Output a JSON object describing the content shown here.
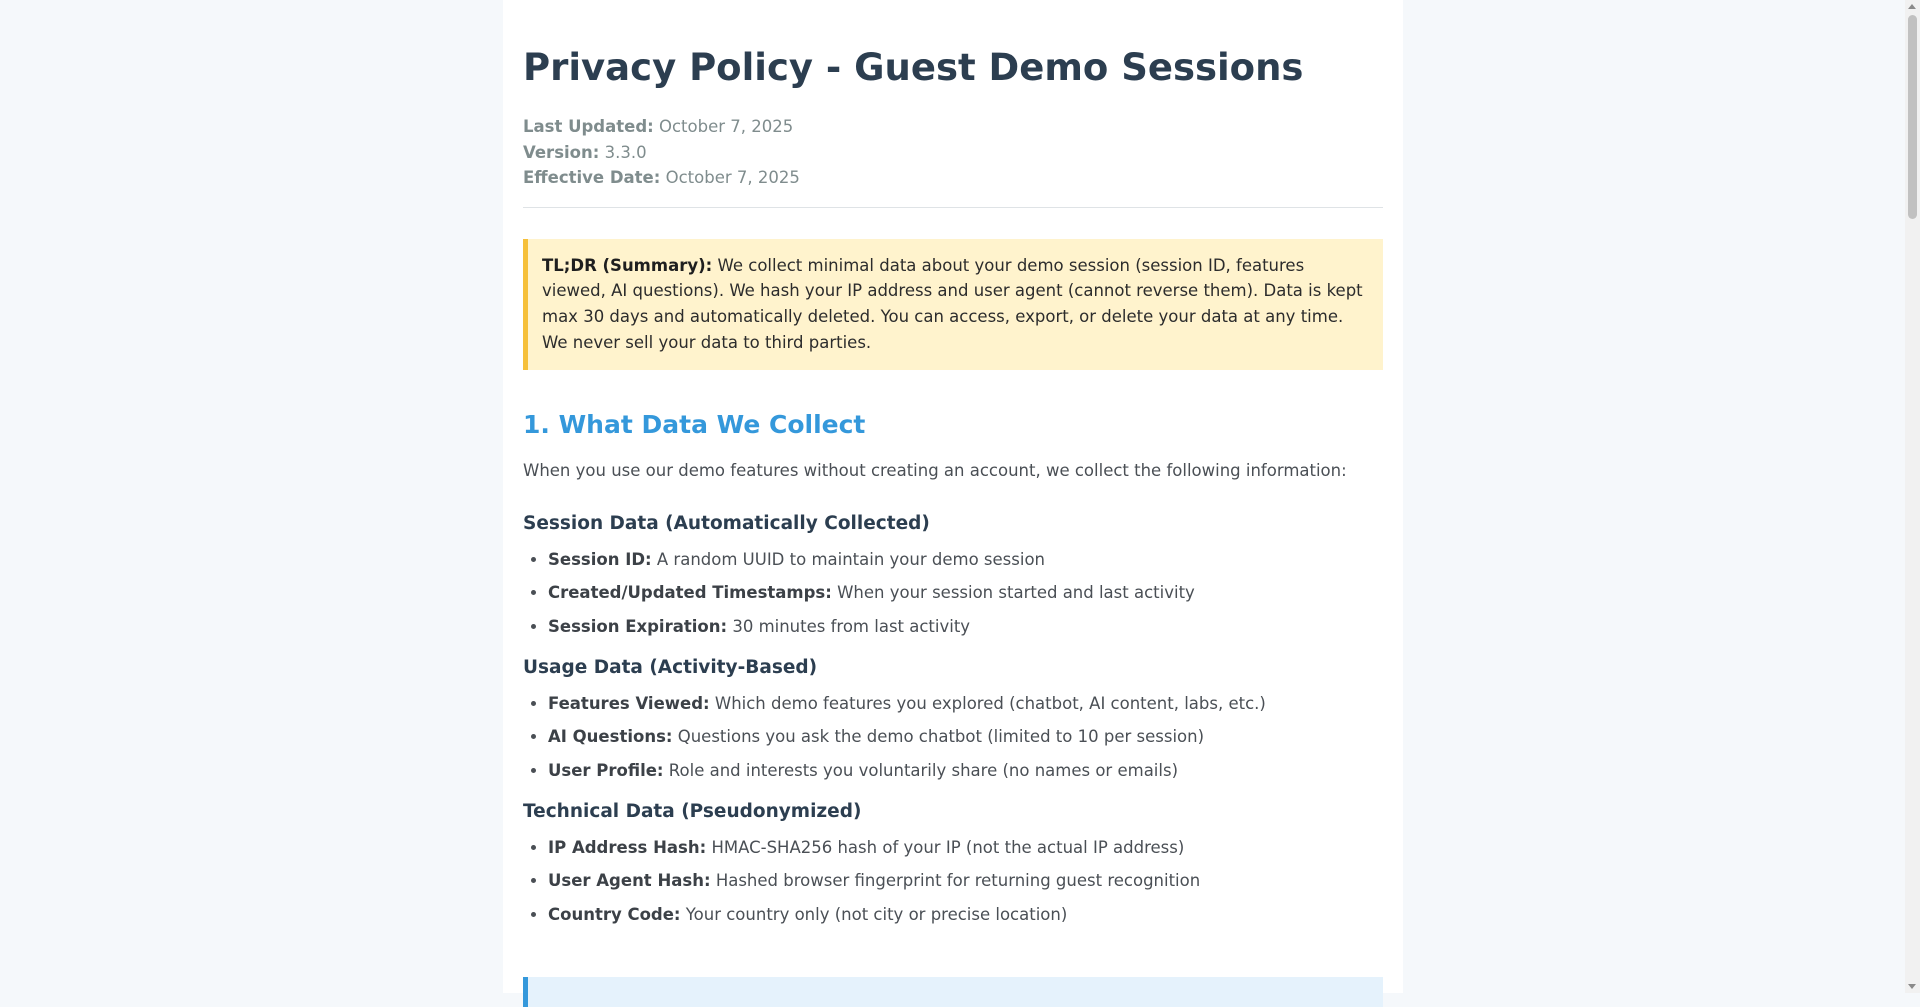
{
  "document": {
    "title": "Privacy Policy - Guest Demo Sessions",
    "meta": [
      {
        "label": "Last Updated:",
        "value": "October 7, 2025"
      },
      {
        "label": "Version:",
        "value": "3.3.0"
      },
      {
        "label": "Effective Date:",
        "value": "October 7, 2025"
      }
    ],
    "tldr": {
      "label": "TL;DR (Summary):",
      "text": "We collect minimal data about your demo session (session ID, features viewed, AI questions). We hash your IP address and user agent (cannot reverse them). Data is kept max 30 days and automatically deleted. You can access, export, or delete your data at any time. We never sell your data to third parties."
    },
    "section1": {
      "heading": "1. What Data We Collect",
      "intro": "When you use our demo features without creating an account, we collect the following information:",
      "groups": [
        {
          "title": "Session Data (Automatically Collected)",
          "items": [
            {
              "label": "Session ID:",
              "text": "A random UUID to maintain your demo session"
            },
            {
              "label": "Created/Updated Timestamps:",
              "text": "When your session started and last activity"
            },
            {
              "label": "Session Expiration:",
              "text": "30 minutes from last activity"
            }
          ]
        },
        {
          "title": "Usage Data (Activity-Based)",
          "items": [
            {
              "label": "Features Viewed:",
              "text": "Which demo features you explored (chatbot, AI content, labs, etc.)"
            },
            {
              "label": "AI Questions:",
              "text": "Questions you ask the demo chatbot (limited to 10 per session)"
            },
            {
              "label": "User Profile:",
              "text": "Role and interests you voluntarily share (no names or emails)"
            }
          ]
        },
        {
          "title": "Technical Data (Pseudonymized)",
          "items": [
            {
              "label": "IP Address Hash:",
              "text": "HMAC-SHA256 hash of your IP (not the actual IP address)"
            },
            {
              "label": "User Agent Hash:",
              "text": "Hashed browser fingerprint for returning guest recognition"
            },
            {
              "label": "Country Code:",
              "text": "Your country only (not city or precise location)"
            }
          ]
        }
      ]
    }
  },
  "colors": {
    "title": "#2c3e50",
    "section_heading": "#3498db",
    "tldr_background": "#fff3cd",
    "tldr_border": "#f6c03a",
    "notice_background": "#e5f2fc",
    "notice_border": "#3498db"
  }
}
